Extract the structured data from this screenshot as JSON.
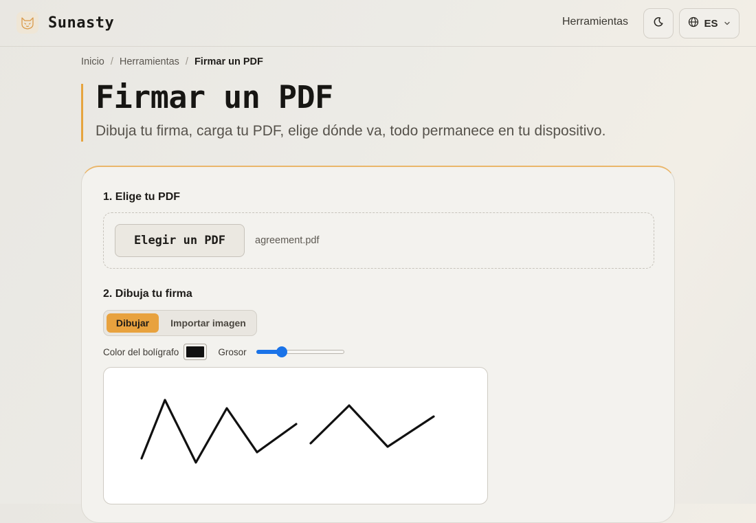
{
  "header": {
    "brand_name": "Sunasty",
    "nav_tools_label": "Herramientas",
    "language_code": "ES"
  },
  "breadcrumb": {
    "home": "Inicio",
    "tools": "Herramientas",
    "current": "Firmar un PDF"
  },
  "page": {
    "title": "Firmar un PDF",
    "subtitle": "Dibuja tu firma, carga tu PDF, elige dónde va, todo permanece en tu dispositivo."
  },
  "step1": {
    "title": "1. Elige tu PDF",
    "choose_button": "Elegir un PDF",
    "file_name": "agreement.pdf"
  },
  "step2": {
    "title": "2. Dibuja tu firma",
    "mode_draw": "Dibujar",
    "mode_import": "Importar imagen",
    "active_mode": "Dibujar",
    "pen_color_label": "Color del bolígrafo",
    "pen_color": "#111111",
    "thickness_label": "Grosor",
    "thickness_level": 0.26
  },
  "colors": {
    "accent": "#e8a23e",
    "slider": "#1a73e8"
  },
  "icons": {
    "brand": "fox-logo-icon",
    "theme": "moon-icon",
    "language": "globe-icon",
    "language_caret": "chevron-down-icon"
  }
}
